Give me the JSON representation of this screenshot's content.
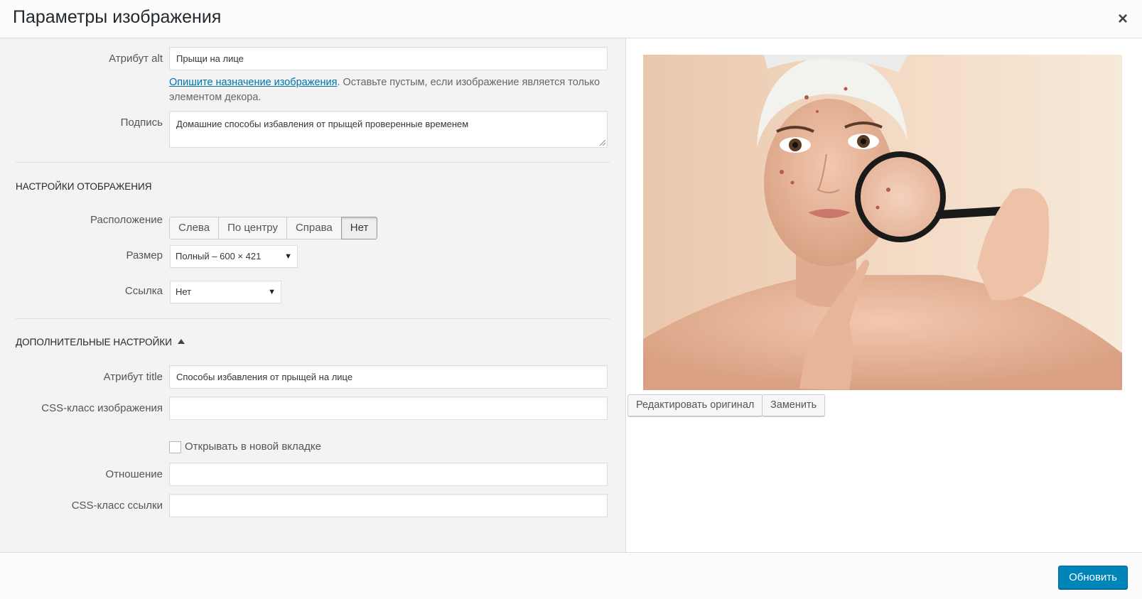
{
  "header": {
    "title": "Параметры изображения",
    "close": "×"
  },
  "details": {
    "alt_label": "Атрибут alt",
    "alt_value": "Прыщи на лице",
    "alt_help_link": "Опишите назначение изображения",
    "alt_help_text": ". Оставьте пустым, если изображение является только элементом декора.",
    "caption_label": "Подпись",
    "caption_value": "Домашние способы избавления от прыщей проверенные временем"
  },
  "display": {
    "heading": "Настройки отображения",
    "align_label": "Расположение",
    "align_options": [
      "Слева",
      "По центру",
      "Справа",
      "Нет"
    ],
    "align_selected": "Нет",
    "size_label": "Размер",
    "size_value": "Полный – 600 × 421",
    "link_label": "Ссылка",
    "link_value": "Нет"
  },
  "advanced": {
    "heading": "Дополнительные настройки",
    "title_label": "Атрибут title",
    "title_value": "Способы избавления от прыщей на лице",
    "css_class_label": "CSS-класс изображения",
    "css_class_value": "",
    "new_tab_label": "Открывать в новой вкладке",
    "new_tab_checked": false,
    "rel_label": "Отношение",
    "rel_value": "",
    "link_class_label": "CSS-класс ссылки",
    "link_class_value": ""
  },
  "preview": {
    "edit_original": "Редактировать оригинал",
    "replace": "Заменить"
  },
  "footer": {
    "update_button": "Обновить"
  },
  "colors": {
    "primary": "#0085ba",
    "link": "#0073aa",
    "pane_bg": "#f3f3f3"
  }
}
